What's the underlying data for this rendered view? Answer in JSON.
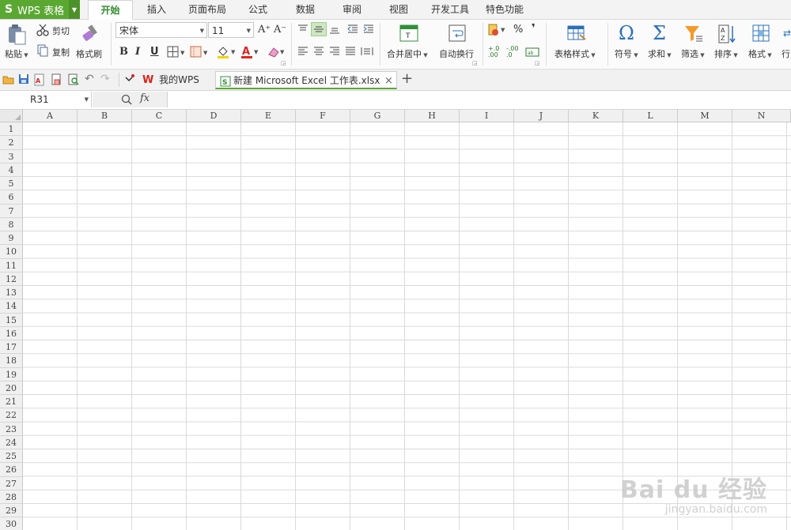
{
  "app": {
    "logo_letter": "S",
    "name": "WPS 表格"
  },
  "menu_tabs": [
    "开始",
    "插入",
    "页面布局",
    "公式",
    "数据",
    "审阅",
    "视图",
    "开发工具",
    "特色功能"
  ],
  "active_menu_tab": "开始",
  "ribbon": {
    "paste_label": "粘贴",
    "cut_label": "剪切",
    "copy_label": "复制",
    "format_painter_label": "格式刷",
    "font_name": "宋体",
    "font_size": "11",
    "grow_font": "A⁺",
    "shrink_font": "A⁻",
    "bold": "B",
    "italic": "I",
    "underline": "U",
    "merge_center_label": "合并居中",
    "wrap_text_label": "自动换行",
    "percent": "%",
    "comma": "❜",
    "inc_decimal": "+.0 .00",
    "dec_decimal": "-.00 .0",
    "table_style_label": "表格样式",
    "symbol_label": "符号",
    "sum_label": "求和",
    "filter_label": "筛选",
    "sort_label": "排序",
    "format_label": "格式",
    "rowcol_label": "行"
  },
  "quick_access": {
    "my_wps_label": "我的WPS"
  },
  "document_tab": {
    "title": "新建 Microsoft Excel 工作表.xlsx"
  },
  "formula_bar": {
    "name_box": "R31",
    "fx_label": "fx",
    "formula": ""
  },
  "grid": {
    "columns": [
      "A",
      "B",
      "C",
      "D",
      "E",
      "F",
      "G",
      "H",
      "I",
      "J",
      "K",
      "L",
      "M",
      "N"
    ],
    "rows": [
      "1",
      "2",
      "3",
      "4",
      "5",
      "6",
      "7",
      "8",
      "9",
      "10",
      "11",
      "12",
      "13",
      "14",
      "15",
      "16",
      "17",
      "18",
      "19",
      "20",
      "21",
      "22",
      "23",
      "24",
      "25",
      "26",
      "27",
      "28",
      "29",
      "30"
    ]
  },
  "watermark": {
    "brand": "Bai du 经验",
    "url": "jingyan.baidu.com"
  },
  "colors": {
    "accent_green": "#5aa832",
    "active_tab_text": "#2e8b2e",
    "grid_line": "#dadada",
    "header_bg": "#f0f0f0"
  },
  "icons": [
    "paste-icon",
    "cut-icon",
    "copy-icon",
    "format-painter-icon",
    "border-icon",
    "fill-color-icon",
    "font-color-icon",
    "clear-icon",
    "merge-center-icon",
    "wrap-text-icon",
    "table-style-icon",
    "symbol-icon",
    "sum-icon",
    "filter-icon",
    "sort-icon",
    "format-icon",
    "open-icon",
    "save-icon",
    "pdf-icon",
    "print-icon",
    "print-preview-icon",
    "undo-icon",
    "redo-icon",
    "customize-icon",
    "wps-logo-icon",
    "excel-file-icon",
    "close-icon",
    "new-tab-icon",
    "zoom-icon"
  ]
}
